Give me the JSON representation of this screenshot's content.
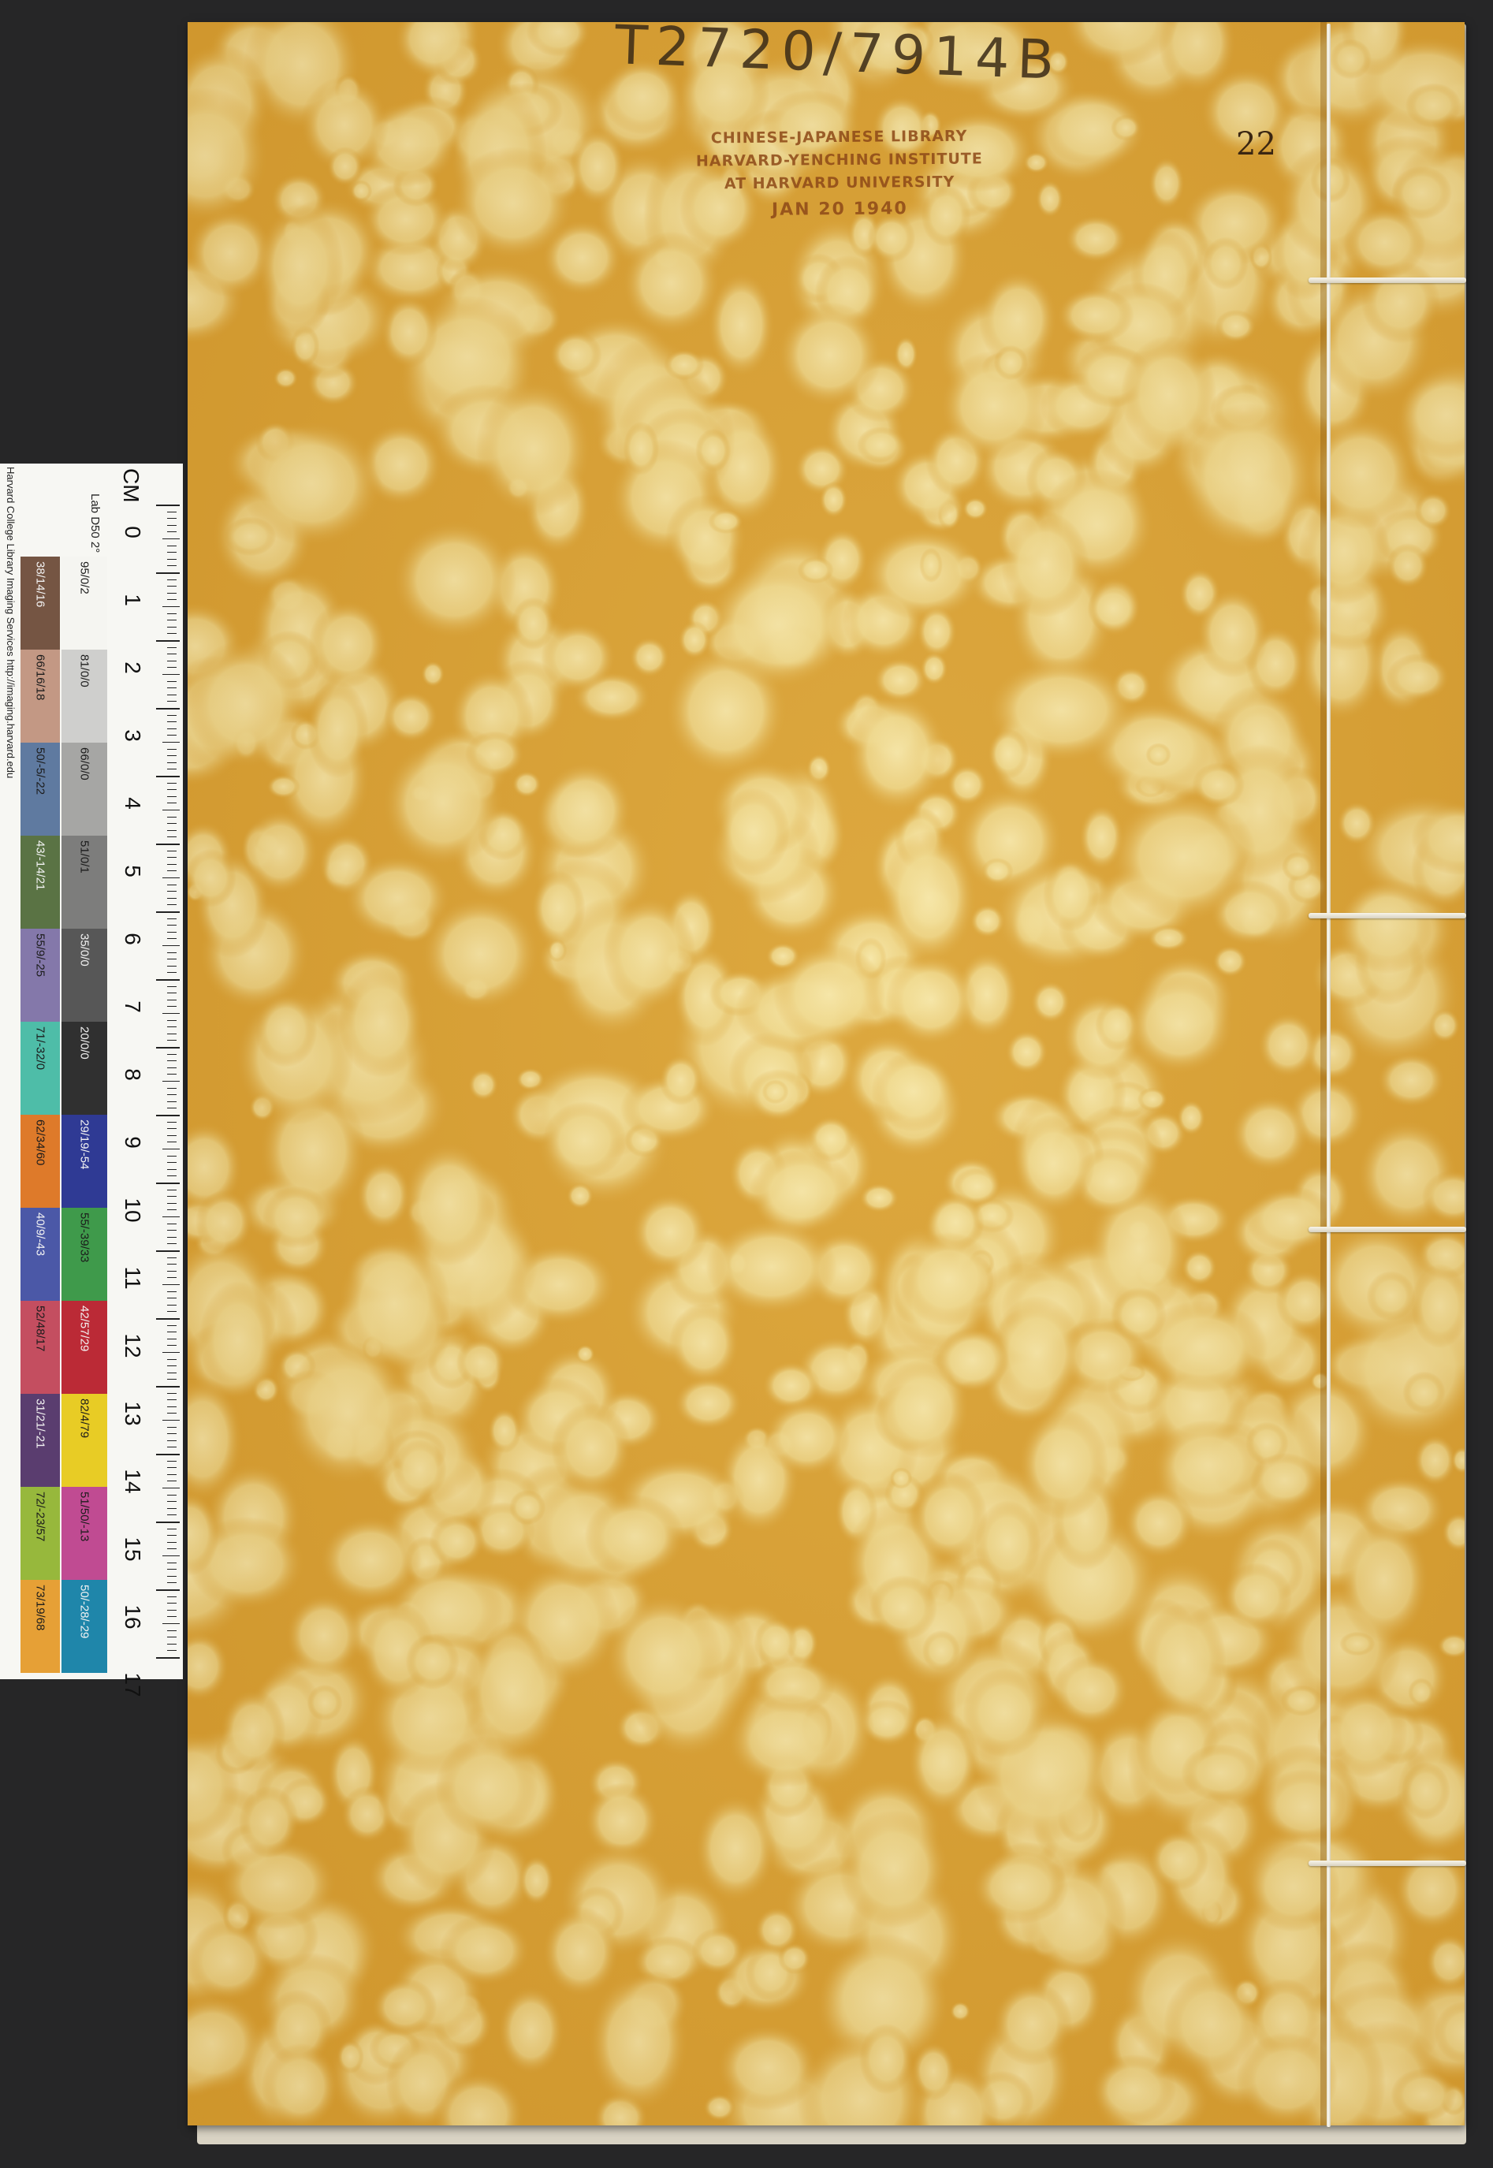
{
  "cover": {
    "call_number": "T2720/7914B",
    "volume_number": "22",
    "stamp": {
      "line1": "CHINESE-JAPANESE LIBRARY",
      "line2": "HARVARD-YENCHING INSTITUTE",
      "line3": "AT HARVARD UNIVERSITY",
      "date": "JAN 20 1940"
    },
    "colors": {
      "base": "#d9a033",
      "light": "#f1e0a0",
      "stitch": "#f6f2e6"
    }
  },
  "color_chart": {
    "credit": "Harvard College Library Imaging Services http://imaging.harvard.edu",
    "unit": "CM",
    "reference": "Lab D50 2°",
    "cm_numbers": [
      "0",
      "1",
      "2",
      "3",
      "4",
      "5",
      "6",
      "7",
      "8",
      "9",
      "10",
      "11",
      "12",
      "13",
      "14",
      "15",
      "16",
      "17"
    ],
    "top_row": [
      {
        "label": "95/0/2",
        "color": "#f5f5f1"
      },
      {
        "label": "81/0/0",
        "color": "#cfcfcd"
      },
      {
        "label": "66/0/0",
        "color": "#a6a6a4"
      },
      {
        "label": "51/0/1",
        "color": "#7d7d7c"
      },
      {
        "label": "35/0/0",
        "color": "#575757"
      },
      {
        "label": "20/0/0",
        "color": "#303030"
      },
      {
        "label": "29/19/-54",
        "color": "#2f3a94"
      },
      {
        "label": "55/-39/33",
        "color": "#3f9a4b"
      },
      {
        "label": "42/57/29",
        "color": "#bb2a36"
      },
      {
        "label": "82/4/79",
        "color": "#e8cc25"
      },
      {
        "label": "51/50/-13",
        "color": "#c04b92"
      },
      {
        "label": "50/-28/-29",
        "color": "#1f86aa"
      }
    ],
    "bottom_row": [
      {
        "label": "38/14/16",
        "color": "#755543"
      },
      {
        "label": "66/16/18",
        "color": "#c39884"
      },
      {
        "label": "50/-5/-22",
        "color": "#5f7aa0"
      },
      {
        "label": "43/-14/21",
        "color": "#5a7344"
      },
      {
        "label": "55/9/-25",
        "color": "#8478aa"
      },
      {
        "label": "71/-32/0",
        "color": "#4ebda8"
      },
      {
        "label": "62/34/60",
        "color": "#de7a2a"
      },
      {
        "label": "40/9/-43",
        "color": "#4b58a7"
      },
      {
        "label": "52/48/17",
        "color": "#c44e60"
      },
      {
        "label": "31/21/-21",
        "color": "#5a3d6f"
      },
      {
        "label": "72/-23/57",
        "color": "#97b83c"
      },
      {
        "label": "73/19/68",
        "color": "#e6a036"
      }
    ]
  }
}
